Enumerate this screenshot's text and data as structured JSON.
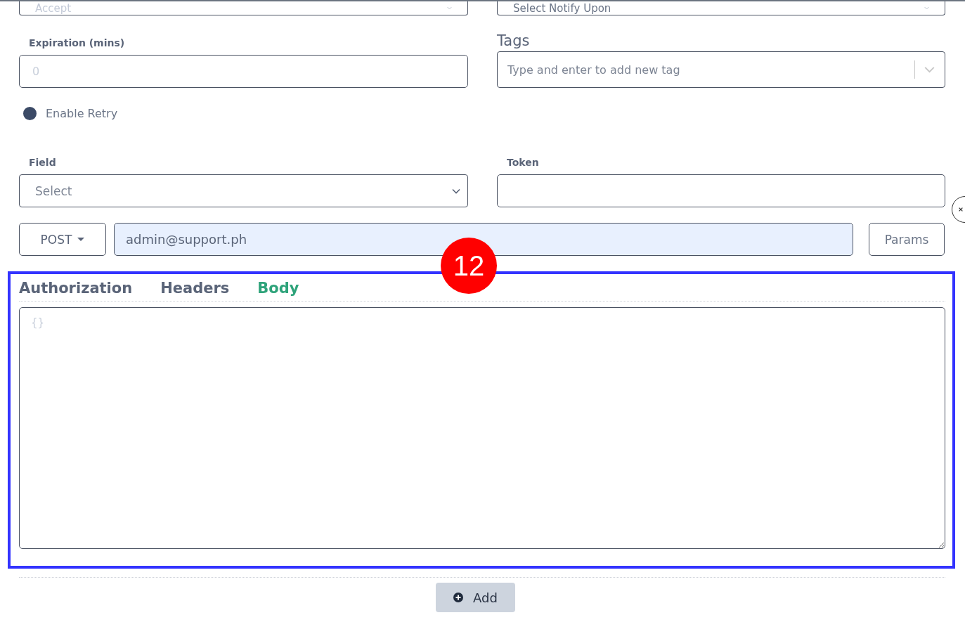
{
  "top_selects": [
    {
      "placeholder": "Accept"
    },
    {
      "placeholder": "Select Notify Upon"
    }
  ],
  "expiration": {
    "label": "Expiration (mins)",
    "placeholder": "0"
  },
  "tags": {
    "label": "Tags",
    "placeholder": "Type and enter to add new tag"
  },
  "retry": {
    "label": "Enable Retry",
    "checked": true
  },
  "field": {
    "label": "Field",
    "placeholder": "Select"
  },
  "token": {
    "label": "Token"
  },
  "request": {
    "method": "POST",
    "url": "admin@support.ph",
    "params_button": "Params"
  },
  "annotation": {
    "label": "12"
  },
  "tabs": [
    {
      "label": "Authorization",
      "selected": false
    },
    {
      "label": "Headers",
      "selected": false
    },
    {
      "label": "Body",
      "selected": true
    }
  ],
  "body": {
    "placeholder": "{}"
  },
  "add_button": "Add"
}
